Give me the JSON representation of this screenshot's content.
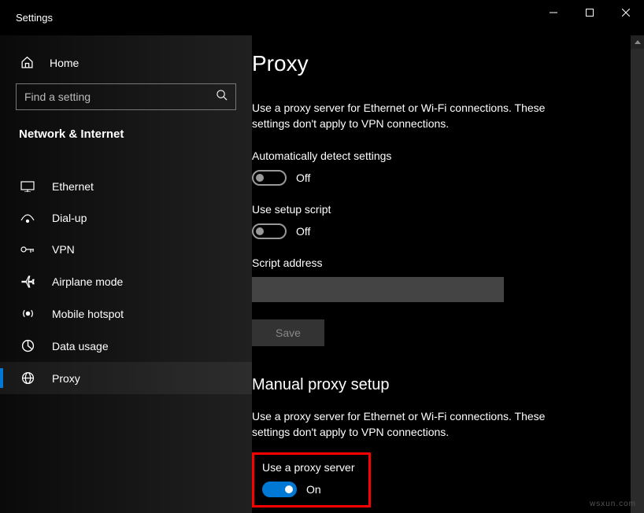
{
  "window": {
    "title": "Settings"
  },
  "sidebar": {
    "home": "Home",
    "search_placeholder": "Find a setting",
    "category": "Network & Internet",
    "items": [
      {
        "label": "Ethernet"
      },
      {
        "label": "Dial-up"
      },
      {
        "label": "VPN"
      },
      {
        "label": "Airplane mode"
      },
      {
        "label": "Mobile hotspot"
      },
      {
        "label": "Data usage"
      },
      {
        "label": "Proxy"
      }
    ]
  },
  "main": {
    "title": "Proxy",
    "desc1": "Use a proxy server for Ethernet or Wi-Fi connections. These settings don't apply to VPN connections.",
    "auto_detect_label": "Automatically detect settings",
    "auto_detect_state": "Off",
    "setup_script_label": "Use setup script",
    "setup_script_state": "Off",
    "script_address_label": "Script address",
    "script_address_value": "",
    "save_label": "Save",
    "manual_title": "Manual proxy setup",
    "desc2": "Use a proxy server for Ethernet or Wi-Fi connections. These settings don't apply to VPN connections.",
    "use_proxy_label": "Use a proxy server",
    "use_proxy_state": "On"
  },
  "watermark": "wsxun.com"
}
